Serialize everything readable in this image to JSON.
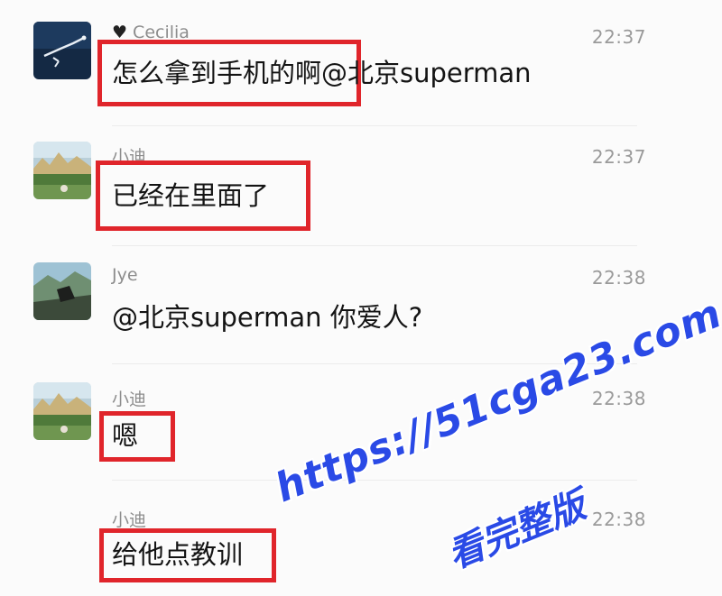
{
  "messages": [
    {
      "name": "Cecilia",
      "name_prefix_icon": "heart-icon",
      "time": "22:37",
      "text": "怎么拿到手机的啊@北京superman",
      "highlighted": true
    },
    {
      "name": "小迪",
      "time": "22:37",
      "text": "已经在里面了",
      "highlighted": true
    },
    {
      "name": "Jye",
      "time": "22:38",
      "text": "@北京superman 你爱人?",
      "highlighted": false
    },
    {
      "name": "小迪",
      "time": "22:38",
      "text": "嗯",
      "highlighted": true
    },
    {
      "name": "小迪",
      "time": "22:38",
      "text": "给他点教训",
      "highlighted": true
    }
  ],
  "watermark": {
    "url": "https://51cga23.com",
    "subtitle": "看完整版"
  },
  "colors": {
    "highlight_box": "#e0252b",
    "watermark": "#2a4ae6",
    "name_text": "#8d8d8d",
    "time_text": "#9a9a9a"
  }
}
